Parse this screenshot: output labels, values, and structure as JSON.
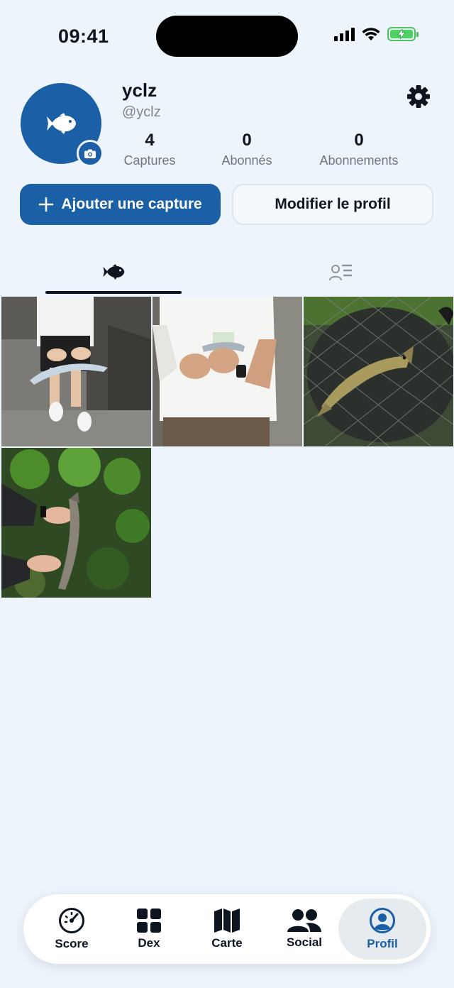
{
  "status_bar": {
    "time": "09:41"
  },
  "profile": {
    "username": "yclz",
    "handle": "@yclz",
    "stats": [
      {
        "value": "4",
        "label": "Captures"
      },
      {
        "value": "0",
        "label": "Abonnés"
      },
      {
        "value": "0",
        "label": "Abonnements"
      }
    ]
  },
  "actions": {
    "add_capture": "Ajouter une capture",
    "edit_profile": "Modifier le profil"
  },
  "tabs": [
    {
      "icon": "fish-icon",
      "active": true
    },
    {
      "icon": "profile-list-icon",
      "active": false
    }
  ],
  "captures": [
    {
      "image": "person-holding-long-silver-fish-on-quay"
    },
    {
      "image": "person-in-white-tshirt-holding-small-fish"
    },
    {
      "image": "brown-trout-in-landing-net"
    },
    {
      "image": "hands-holding-trout-among-green-leaves"
    }
  ],
  "nav": [
    {
      "label": "Score",
      "icon": "gauge-icon",
      "active": false
    },
    {
      "label": "Dex",
      "icon": "grid-icon",
      "active": false
    },
    {
      "label": "Carte",
      "icon": "map-icon",
      "active": false
    },
    {
      "label": "Social",
      "icon": "people-icon",
      "active": false
    },
    {
      "label": "Profil",
      "icon": "profile-icon",
      "active": true
    }
  ],
  "colors": {
    "accent": "#1b5fa6",
    "background": "#eef4fb",
    "battery": "#4cd164"
  }
}
